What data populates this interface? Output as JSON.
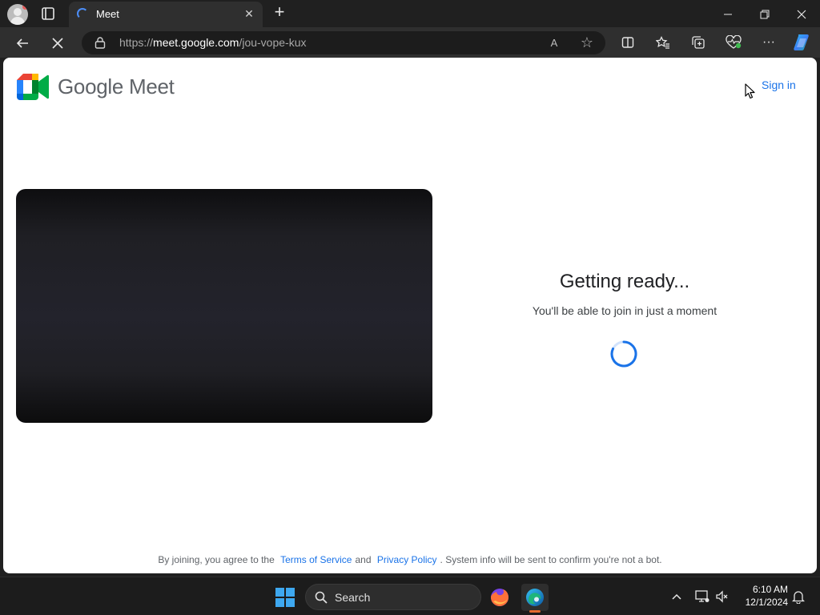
{
  "browser": {
    "tab": {
      "title": "Meet"
    },
    "new_tab_label": "+",
    "address_bar": {
      "prefix": "https://",
      "host": "meet.google.com",
      "path": "/jou-vope-kux"
    },
    "icons": {
      "back": "back-arrow-icon",
      "stop": "stop-loading-icon",
      "lock": "lock-icon",
      "read_aloud": "read-aloud-icon",
      "favorite": "star-icon",
      "split": "split-screen-icon",
      "favorites": "favorites-icon",
      "collections": "collections-icon",
      "performance": "browser-essentials-icon",
      "more": "more-icon",
      "copilot": "copilot-icon"
    },
    "read_aloud_label": "A",
    "more_label": "···"
  },
  "page": {
    "logo_text": "Google Meet",
    "sign_in": "Sign in",
    "status": {
      "heading": "Getting ready...",
      "subtext": "You'll be able to join in just a moment"
    },
    "footer": {
      "prefix": "By joining, you agree to the",
      "terms": "Terms of Service",
      "and": "and",
      "privacy": "Privacy Policy",
      "suffix": ". System info will be sent to confirm you're not a bot."
    },
    "colors": {
      "link": "#1a73e8",
      "logo_green": "#00832d",
      "logo_blue": "#0066da",
      "logo_red": "#e94235",
      "logo_yellow": "#ffba00",
      "logo_darkgreen": "#00ac47"
    }
  },
  "taskbar": {
    "search_placeholder": "Search",
    "time": "6:10 AM",
    "date": "12/1/2024",
    "apps": [
      "firefox-icon",
      "edge-icon"
    ],
    "tray_chevron": "^"
  }
}
